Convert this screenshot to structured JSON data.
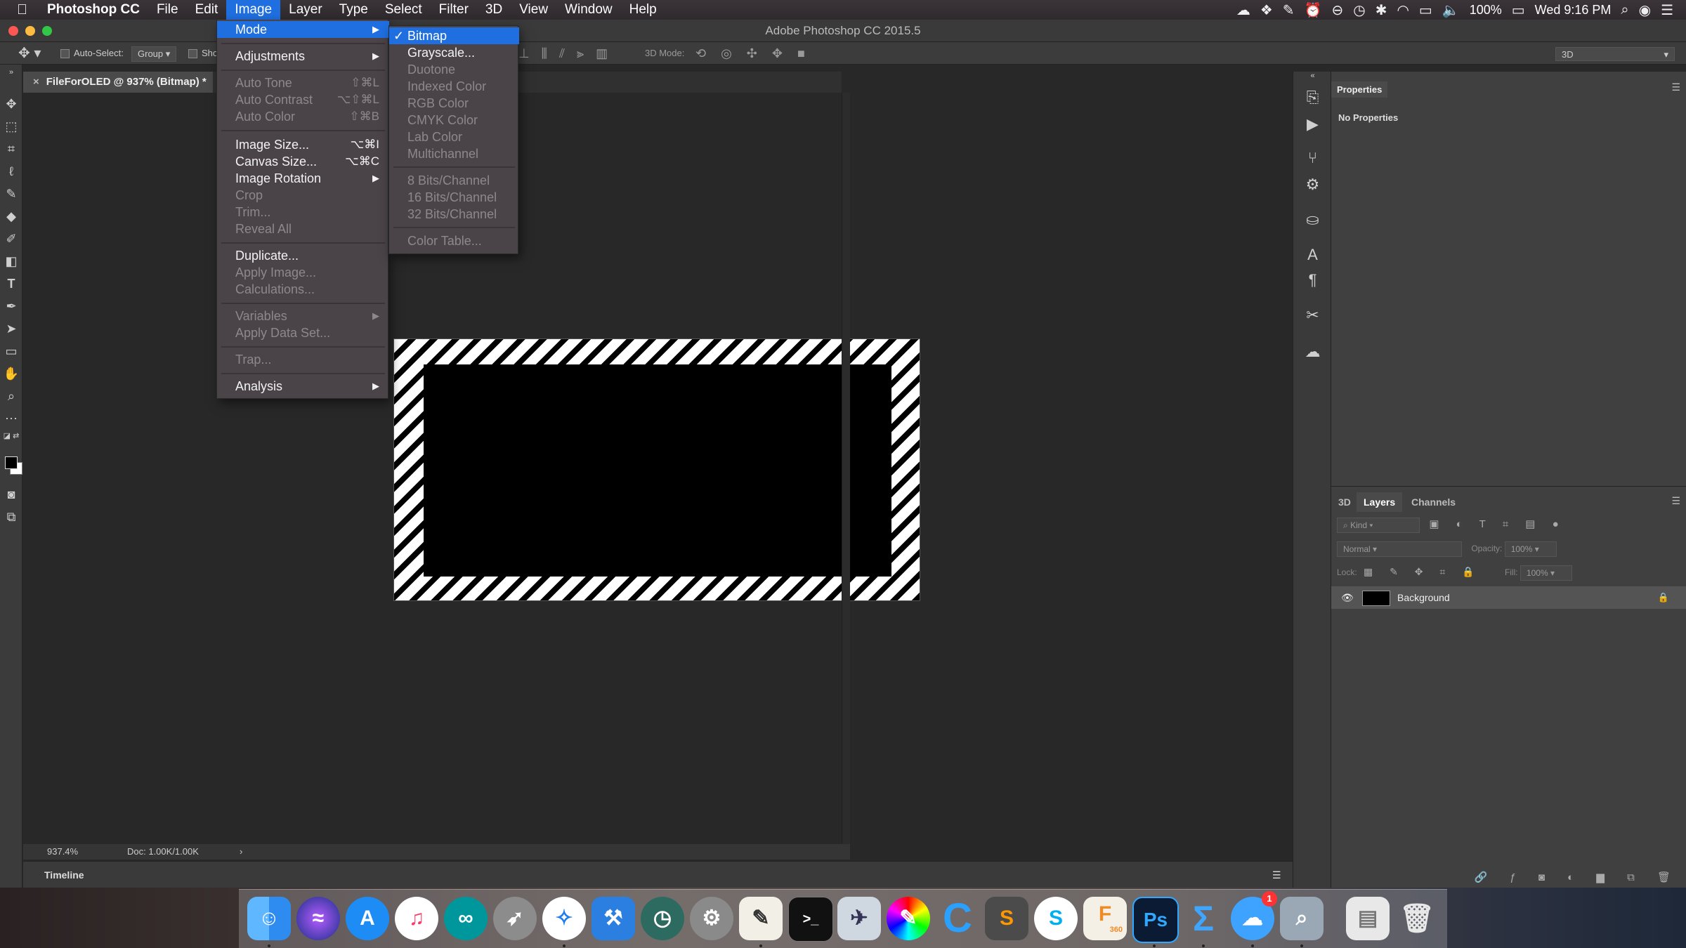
{
  "menubar": {
    "app_name": "Photoshop CC",
    "items": [
      "File",
      "Edit",
      "Image",
      "Layer",
      "Type",
      "Select",
      "Filter",
      "3D",
      "View",
      "Window",
      "Help"
    ],
    "active_item": "Image",
    "battery": "100%",
    "clock": "Wed 9:16 PM"
  },
  "window": {
    "title": "Adobe Photoshop CC 2015.5"
  },
  "options_bar": {
    "auto_select_label": "Auto-Select:",
    "auto_select_value": "Group",
    "show_label": "Sho",
    "mode_3d_label": "3D Mode:",
    "workspace": "3D"
  },
  "document": {
    "tab_title": "FileForOLED @ 937% (Bitmap) *"
  },
  "status": {
    "zoom": "937.4%",
    "doc": "Doc: 1.00K/1.00K"
  },
  "timeline": {
    "label": "Timeline"
  },
  "properties": {
    "tab": "Properties",
    "empty_text": "No Properties"
  },
  "layers": {
    "tabs": [
      "3D",
      "Layers",
      "Channels"
    ],
    "active_tab": "Layers",
    "filter_placeholder": "Kind",
    "blend_mode": "Normal",
    "opacity_label": "Opacity:",
    "opacity_value": "100%",
    "lock_label": "Lock:",
    "fill_label": "Fill:",
    "fill_value": "100%",
    "layer_name": "Background"
  },
  "image_menu": {
    "items": [
      {
        "label": "Mode",
        "shortcut": "",
        "submenu": true,
        "disabled": false,
        "highlight": true
      },
      {
        "label": "Adjustments",
        "shortcut": "",
        "submenu": true,
        "disabled": false
      },
      {
        "label": "Auto Tone",
        "shortcut": "⇧⌘L",
        "disabled": true
      },
      {
        "label": "Auto Contrast",
        "shortcut": "⌥⇧⌘L",
        "disabled": true
      },
      {
        "label": "Auto Color",
        "shortcut": "⇧⌘B",
        "disabled": true
      },
      {
        "label": "Image Size...",
        "shortcut": "⌥⌘I",
        "disabled": false
      },
      {
        "label": "Canvas Size...",
        "shortcut": "⌥⌘C",
        "disabled": false
      },
      {
        "label": "Image Rotation",
        "shortcut": "",
        "submenu": true,
        "disabled": false
      },
      {
        "label": "Crop",
        "shortcut": "",
        "disabled": true
      },
      {
        "label": "Trim...",
        "shortcut": "",
        "disabled": true
      },
      {
        "label": "Reveal All",
        "shortcut": "",
        "disabled": true
      },
      {
        "label": "Duplicate...",
        "shortcut": "",
        "disabled": false
      },
      {
        "label": "Apply Image...",
        "shortcut": "",
        "disabled": true
      },
      {
        "label": "Calculations...",
        "shortcut": "",
        "disabled": true
      },
      {
        "label": "Variables",
        "shortcut": "",
        "submenu": true,
        "disabled": true
      },
      {
        "label": "Apply Data Set...",
        "shortcut": "",
        "disabled": true
      },
      {
        "label": "Trap...",
        "shortcut": "",
        "disabled": true
      },
      {
        "label": "Analysis",
        "shortcut": "",
        "submenu": true,
        "disabled": false
      }
    ]
  },
  "mode_submenu": {
    "items": [
      {
        "label": "Bitmap",
        "checked": true,
        "disabled": false,
        "highlight": true
      },
      {
        "label": "Grayscale...",
        "disabled": false
      },
      {
        "label": "Duotone",
        "disabled": true
      },
      {
        "label": "Indexed Color",
        "disabled": true
      },
      {
        "label": "RGB Color",
        "disabled": true
      },
      {
        "label": "CMYK Color",
        "disabled": true
      },
      {
        "label": "Lab Color",
        "disabled": true
      },
      {
        "label": "Multichannel",
        "disabled": true
      },
      {
        "label": "8 Bits/Channel",
        "disabled": true
      },
      {
        "label": "16 Bits/Channel",
        "disabled": true
      },
      {
        "label": "32 Bits/Channel",
        "disabled": true
      },
      {
        "label": "Color Table...",
        "disabled": true
      }
    ]
  },
  "dock": {
    "apps": [
      "finder",
      "siri",
      "app-store",
      "itunes",
      "arduino",
      "launchpad",
      "safari",
      "xcode",
      "time-machine",
      "system-preferences",
      "textedit",
      "terminal",
      "preview",
      "color-picker",
      "c-app",
      "sublime",
      "skype",
      "fusion-360",
      "photoshop",
      "sigma",
      "messages",
      "image-capture",
      "documents",
      "trash"
    ],
    "fusion_label": "F",
    "fusion_sub": "360",
    "photoshop_label": "Ps",
    "sigma_label": "Σ",
    "messages_badge": "1"
  }
}
